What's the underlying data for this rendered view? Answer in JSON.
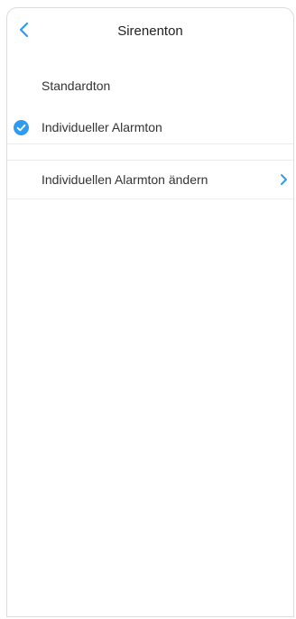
{
  "header": {
    "title": "Sirenenton",
    "back_icon": "chevron-left-icon"
  },
  "options": [
    {
      "label": "Standardton",
      "selected": false
    },
    {
      "label": "Individueller Alarmton",
      "selected": true
    }
  ],
  "nav_row": {
    "label": "Individuellen Alarmton ändern",
    "icon": "chevron-right-icon"
  },
  "colors": {
    "accent": "#2f9bf0",
    "text": "#333333",
    "divider": "#ececec"
  }
}
